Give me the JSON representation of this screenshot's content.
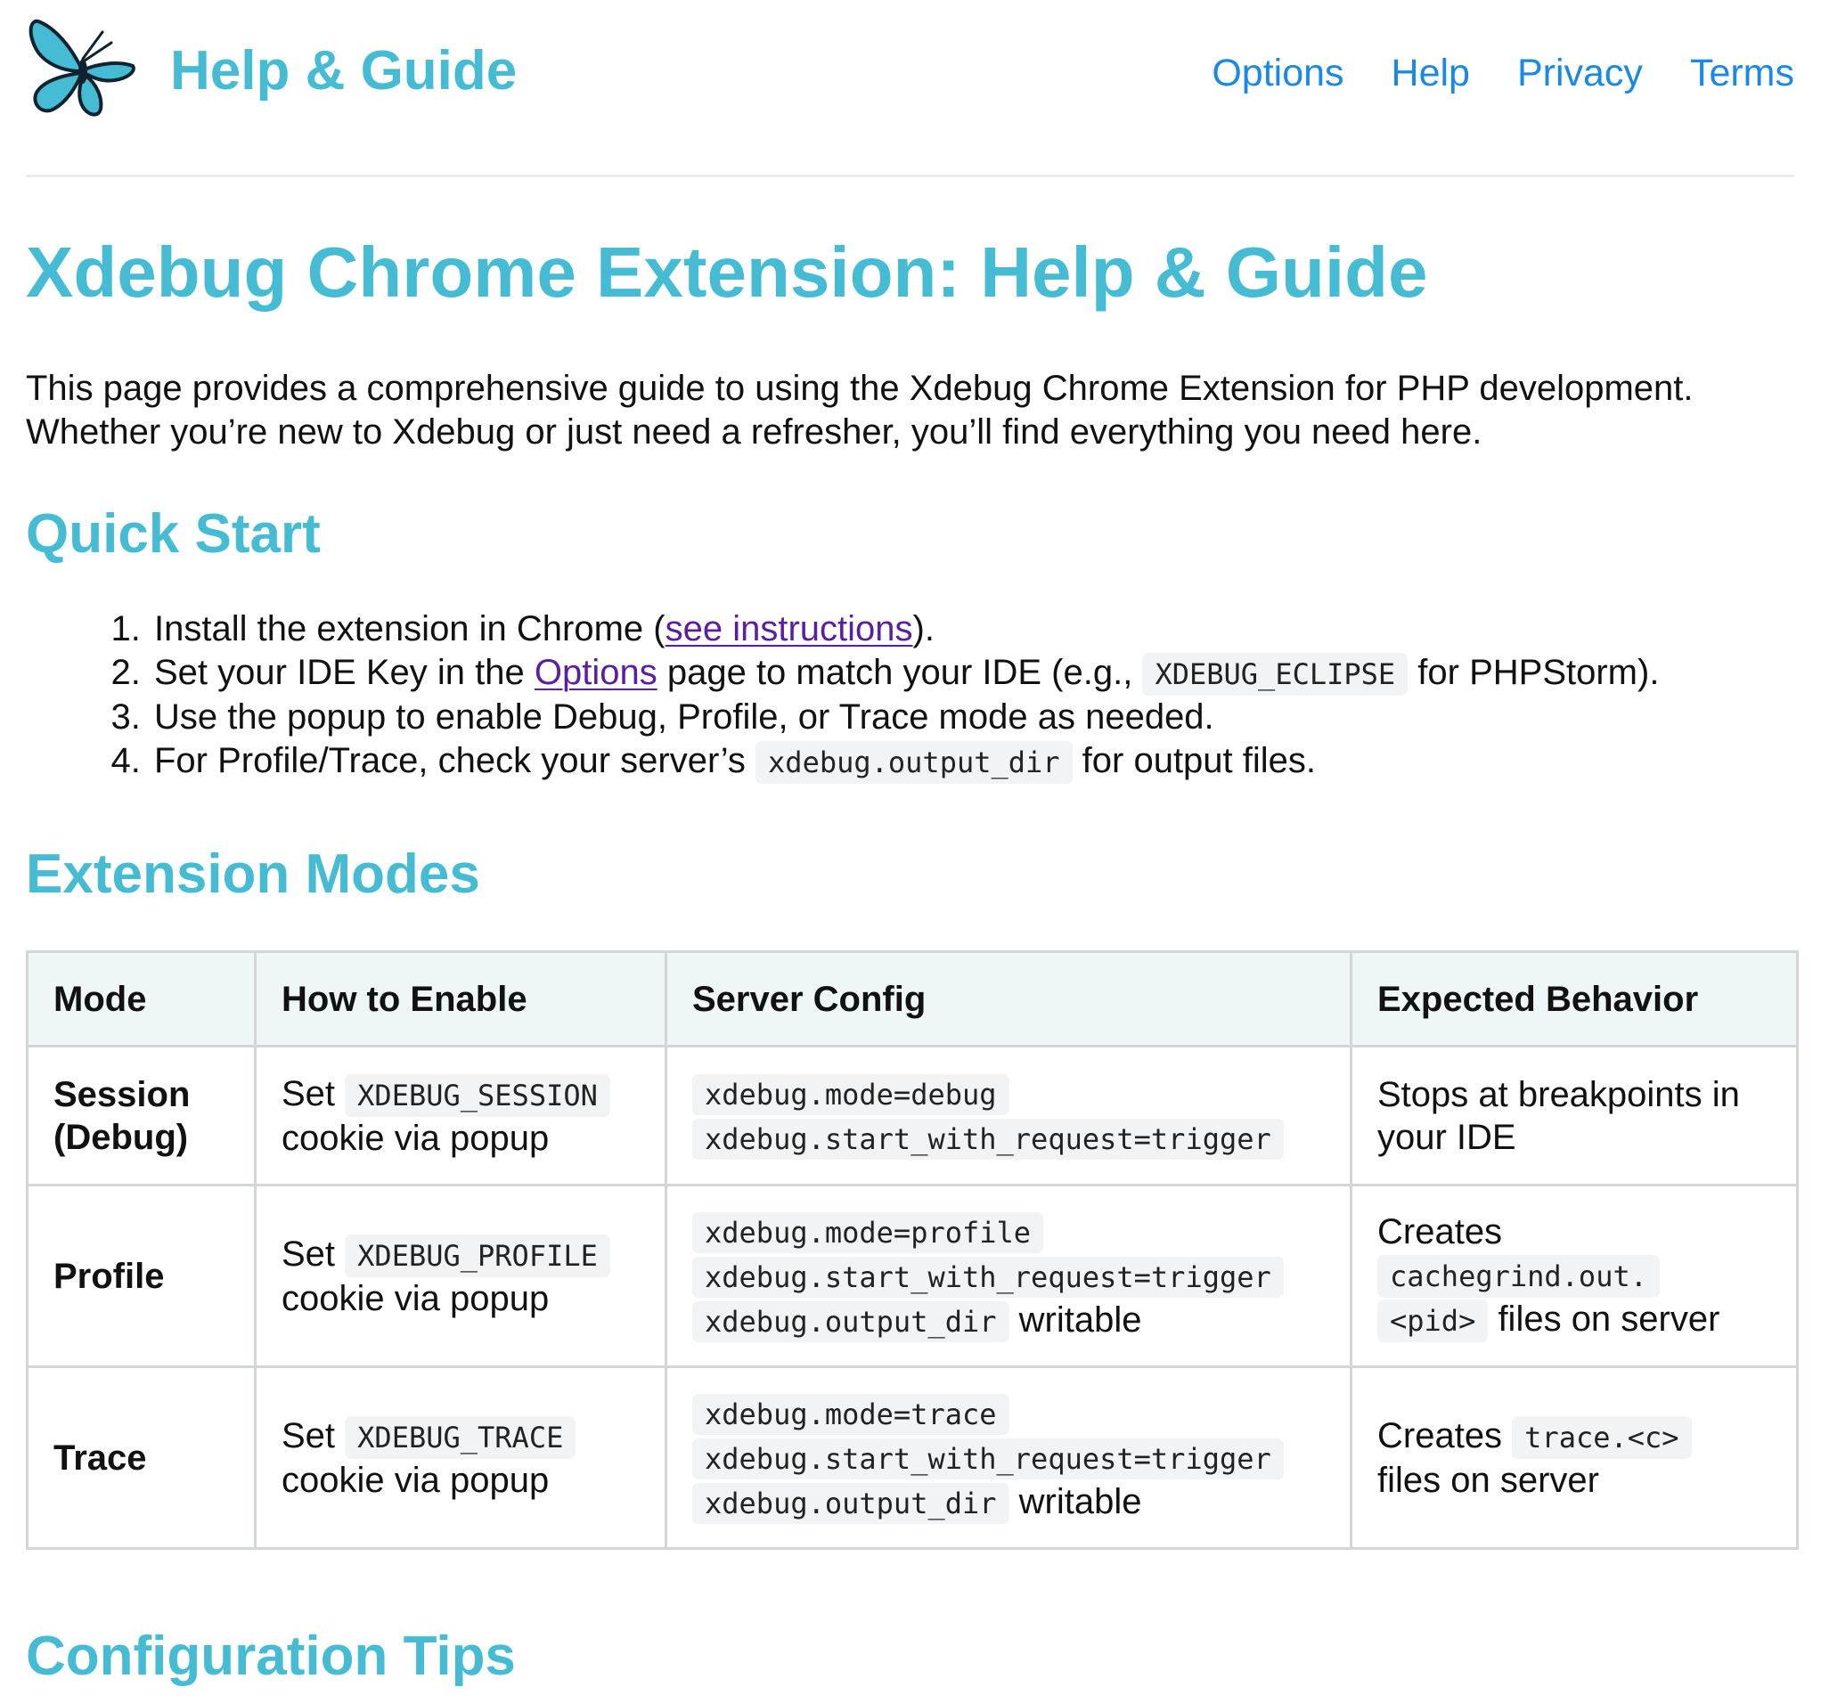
{
  "header": {
    "brand": "Help & Guide",
    "logo_icon": "butterfly-icon",
    "nav": [
      "Options",
      "Help",
      "Privacy",
      "Terms"
    ]
  },
  "colors": {
    "accent": "#45bcd4",
    "link": "#1a88e6",
    "visited": "#5a1ea2"
  },
  "page_title": "Xdebug Chrome Extension: Help & Guide",
  "intro": {
    "line1": "This page provides a comprehensive guide to using the Xdebug Chrome Extension for PHP development.",
    "line2": "Whether you’re new to Xdebug or just need a refresher, you’ll find everything you need here."
  },
  "quick_start": {
    "heading": "Quick Start",
    "steps": [
      {
        "before": "Install the extension in Chrome (",
        "link": "see instructions",
        "after": ")."
      },
      {
        "before": "Set your IDE Key in the ",
        "link": "Options",
        "middle": " page to match your IDE (e.g., ",
        "code": "XDEBUG_ECLIPSE",
        "after": " for PHPStorm)."
      },
      {
        "text": "Use the popup to enable Debug, Profile, or Trace mode as needed."
      },
      {
        "before": "For Profile/Trace, check your server’s ",
        "code": "xdebug.output_dir",
        "after": " for output files."
      }
    ]
  },
  "modes": {
    "heading": "Extension Modes",
    "columns": [
      "Mode",
      "How to Enable",
      "Server Config",
      "Expected Behavior"
    ],
    "rows": [
      {
        "mode_line1": "Session",
        "mode_line2": "(Debug)",
        "enable_prefix": "Set ",
        "enable_code": "XDEBUG_SESSION",
        "enable_suffix": "cookie via popup",
        "config": [
          "xdebug.mode=debug",
          "xdebug.start_with_request=trigger"
        ],
        "behavior": "Stops at breakpoints in your IDE"
      },
      {
        "mode_line1": "Profile",
        "enable_prefix": "Set ",
        "enable_code": "XDEBUG_PROFILE",
        "enable_suffix": "cookie via popup",
        "config": [
          "xdebug.mode=profile",
          "xdebug.start_with_request=trigger"
        ],
        "config_dir": "xdebug.output_dir",
        "config_dir_suffix": " writable",
        "behavior_prefix": "Creates",
        "behavior_code_1": "cachegrind.out.",
        "behavior_code_2": "<pid>",
        "behavior_suffix": " files on server"
      },
      {
        "mode_line1": "Trace",
        "enable_prefix": "Set ",
        "enable_code": "XDEBUG_TRACE",
        "enable_suffix": "cookie via popup",
        "config": [
          "xdebug.mode=trace",
          "xdebug.start_with_request=trigger"
        ],
        "config_dir": "xdebug.output_dir",
        "config_dir_suffix": " writable",
        "behavior_prefix": "Creates ",
        "behavior_code_1": "trace.<c>",
        "behavior_suffix": "files on server"
      }
    ]
  },
  "config_tips": {
    "heading": "Configuration Tips"
  }
}
